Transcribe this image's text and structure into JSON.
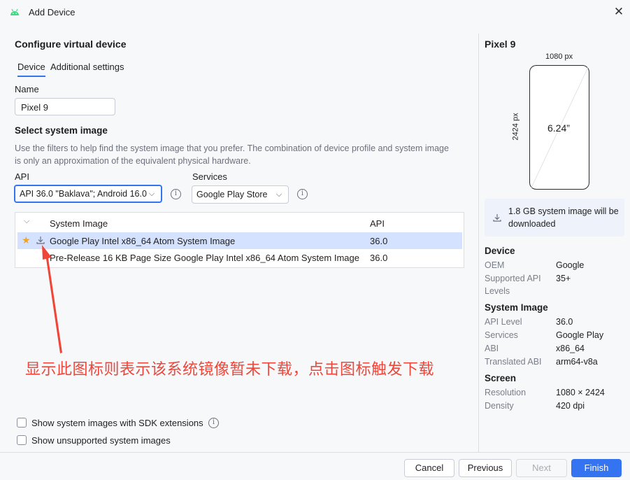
{
  "window": {
    "title": "Add Device",
    "close_glyph": "✕"
  },
  "header": {
    "title": "Configure virtual device"
  },
  "tabs": [
    {
      "label": "Device",
      "active": true
    },
    {
      "label": "Additional settings",
      "active": false
    }
  ],
  "name_field": {
    "label": "Name",
    "value": "Pixel 9"
  },
  "system_image": {
    "title": "Select system image",
    "description": "Use the filters to help find the system image that you prefer. The combination of device profile and system image is only an approximation of the equivalent physical hardware.",
    "api_label": "API",
    "api_value": "API 36.0 \"Baklava\"; Android 16.0",
    "services_label": "Services",
    "services_value": "Google Play Store"
  },
  "table": {
    "columns": [
      "System Image",
      "API"
    ],
    "rows": [
      {
        "name": "Google Play Intel x86_64 Atom System Image",
        "api": "36.0",
        "selected": true,
        "starred": true
      },
      {
        "name": "Pre-Release 16 KB Page Size Google Play Intel x86_64 Atom System Image",
        "api": "36.0",
        "selected": false,
        "starred": false
      }
    ]
  },
  "annotation": "显示此图标则表示该系统镜像暂未下载，点击图标触发下载",
  "options": {
    "sdk_extensions": "Show system images with SDK extensions",
    "unsupported": "Show unsupported system images"
  },
  "buttons": {
    "cancel": "Cancel",
    "previous": "Previous",
    "next": "Next",
    "finish": "Finish"
  },
  "preview": {
    "device_name": "Pixel 9",
    "width_px": "1080 px",
    "height_px": "2424 px",
    "diagonal": "6.24”",
    "download_note": "1.8 GB system image will be downloaded",
    "device": {
      "title": "Device",
      "oem_label": "OEM",
      "oem_value": "Google",
      "api_label": "Supported API Levels",
      "api_value": "35+"
    },
    "system_image": {
      "title": "System Image",
      "api_level_label": "API Level",
      "api_level_value": "36.0",
      "services_label": "Services",
      "services_value": "Google Play",
      "abi_label": "ABI",
      "abi_value": "x86_64",
      "translated_abi_label": "Translated ABI",
      "translated_abi_value": "arm64-v8a"
    },
    "screen": {
      "title": "Screen",
      "resolution_label": "Resolution",
      "resolution_value": "1080 × 2424",
      "density_label": "Density",
      "density_value": "420 dpi"
    }
  },
  "colors": {
    "accent": "#3574f0",
    "annotation": "#f0463a",
    "android": "#3ddc84",
    "star": "#f2a41c"
  }
}
